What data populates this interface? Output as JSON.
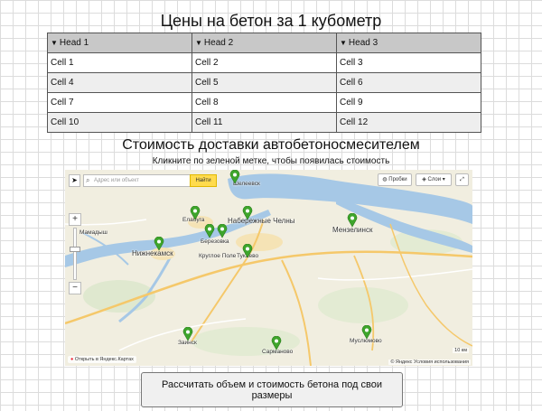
{
  "page_title": "Цены на бетон за 1 кубометр",
  "table": {
    "headers": [
      "Head 1",
      "Head 2",
      "Head 3"
    ],
    "rows": [
      [
        "Cell 1",
        "Cell 2",
        "Cell 3"
      ],
      [
        "Cell 4",
        "Cell 5",
        "Cell 6"
      ],
      [
        "Cell 7",
        "Cell 8",
        "Cell 9"
      ],
      [
        "Cell 10",
        "Cell 11",
        "Cell 12"
      ]
    ]
  },
  "delivery_title": "Стоимость доставки автобетоносмесителем",
  "delivery_hint": "Кликните по зеленой метке, чтобы появилась стоимость",
  "map": {
    "search_placeholder": "Адрес или объект",
    "search_button": "Найти",
    "traffic_button": "Пробки",
    "layers_button": "Слои",
    "zoom_in": "+",
    "zoom_out": "−",
    "cities": {
      "mamadysh": "Мамадыш",
      "elabuga": "Елабуга",
      "naberezhnye_chelny": "Набережные Челны",
      "nizhnekamsk": "Нижнекамск",
      "menzelinsk": "Мензелинск",
      "zainsk": "Заинск",
      "sarmanovo": "Сарманово",
      "muslyumovo": "Муслюмово",
      "kruglon_pole": "Круглое Поле",
      "tukaevo": "Тукаево",
      "beryozovka": "Березовка",
      "sheleevsk": "Шелеевск"
    },
    "open_in_yandex": "Открыть в Яндекс.Картах",
    "scale_label": "10 км",
    "copyright": "© Яндекс Условия использования"
  },
  "calc_button": "Рассчитать объем и стоимость бетона под свои размеры",
  "colors": {
    "pin_green": "#3ea52b",
    "water": "#a6c8e6",
    "header_bg": "#c8c8c8",
    "search_button": "#ffdb4d"
  }
}
